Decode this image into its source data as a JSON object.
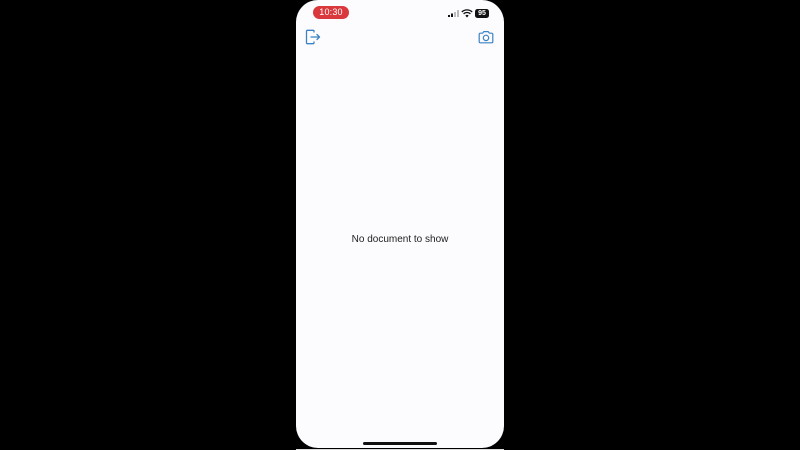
{
  "status_bar": {
    "time": "10:30",
    "battery_level": "95",
    "signal_icon": "cellular-signal-icon",
    "wifi_icon": "wifi-icon"
  },
  "toolbar": {
    "left_icon": "exit-icon",
    "right_icon": "camera-icon"
  },
  "main": {
    "empty_message": "No document to show"
  },
  "colors": {
    "accent": "#3b82c4",
    "time_pill": "#d9383d",
    "screen_background": "#fcfbfd"
  }
}
